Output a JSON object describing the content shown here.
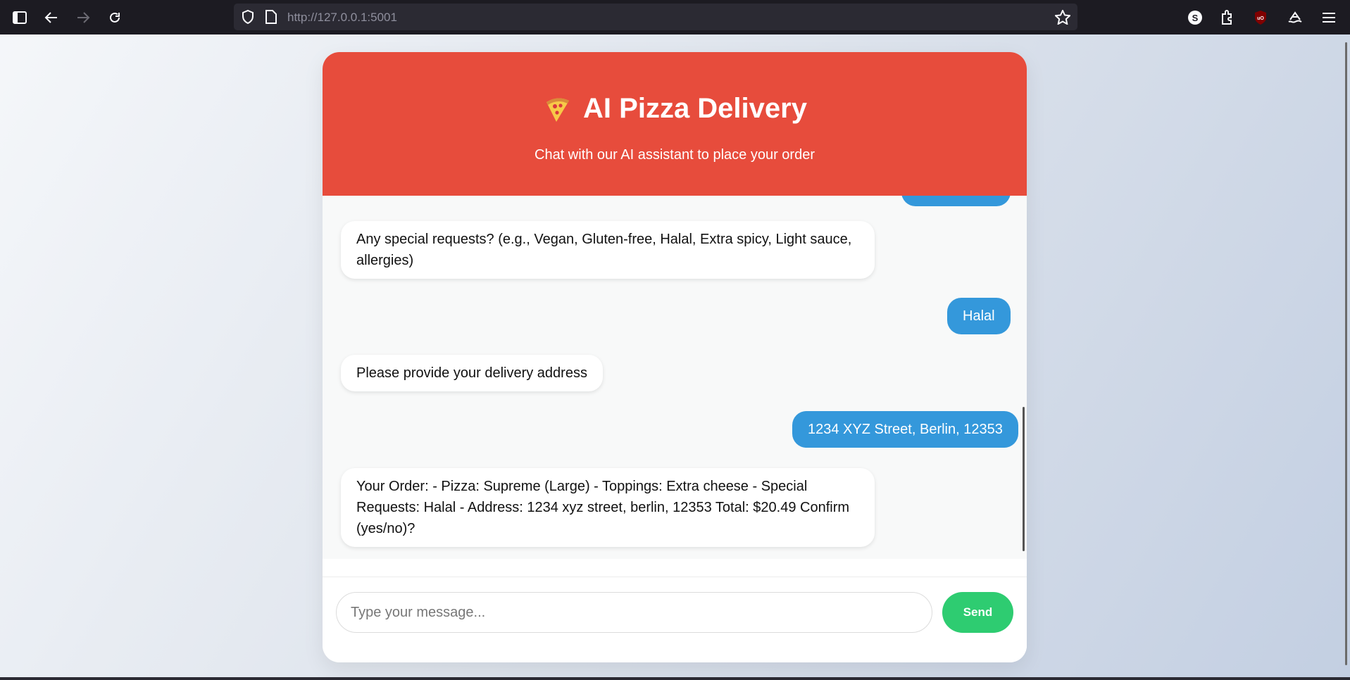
{
  "browser": {
    "url_host": "http://127.0.0.1",
    "url_port": ":5001",
    "icons": [
      "sidebar-icon",
      "back-icon",
      "forward-icon",
      "reload-icon",
      "shield-icon",
      "page-icon",
      "star-icon",
      "account-icon",
      "extensions-icon",
      "ublock-icon",
      "sync-icon",
      "menu-icon"
    ]
  },
  "header": {
    "title": "AI Pizza Delivery",
    "subtitle": "Chat with our AI assistant to place your order",
    "color": "#e74c3c",
    "icon": "pizza-icon"
  },
  "chat": {
    "messages": [
      {
        "sender": "bot",
        "text": "Any special requests? (e.g., Vegan, Gluten-free, Halal, Extra spicy, Light sauce, allergies)"
      },
      {
        "sender": "user",
        "text": "Halal"
      },
      {
        "sender": "bot",
        "text": "Please provide your delivery address"
      },
      {
        "sender": "user",
        "text": "1234 XYZ Street, Berlin, 12353"
      },
      {
        "sender": "bot",
        "text": "Your Order: - Pizza: Supreme (Large) - Toppings: Extra cheese - Special Requests: Halal - Address: 1234 xyz street, berlin, 12353 Total: $20.49 Confirm (yes/no)?"
      }
    ],
    "user_color": "#3498db"
  },
  "input": {
    "placeholder": "Type your message...",
    "value": ""
  },
  "send": {
    "label": "Send",
    "color": "#2ecc71"
  }
}
